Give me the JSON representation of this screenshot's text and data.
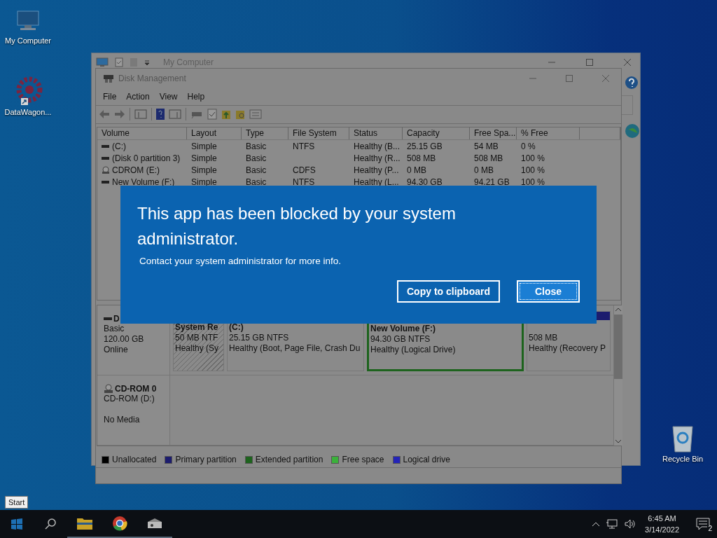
{
  "desktop_icons": [
    {
      "kind": "computer",
      "label": "My Computer"
    },
    {
      "kind": "shortcut",
      "label": "DataWagon..."
    },
    {
      "kind": "bin",
      "label": "Recycle Bin"
    }
  ],
  "back_window": {
    "title": "My Computer"
  },
  "disk_management": {
    "title": "Disk Management",
    "menu": [
      "File",
      "Action",
      "View",
      "Help"
    ],
    "table": {
      "columns": [
        "Volume",
        "Layout",
        "Type",
        "File System",
        "Status",
        "Capacity",
        "Free Spa...",
        "% Free"
      ],
      "rows": [
        {
          "kind": "volume",
          "cells": [
            " (C:)",
            "Simple",
            "Basic",
            "NTFS",
            "Healthy (B...",
            "25.15 GB",
            "54 MB",
            "0 %"
          ]
        },
        {
          "kind": "volume",
          "cells": [
            "(Disk 0 partition 3)",
            "Simple",
            "Basic",
            "",
            "Healthy (R...",
            "508 MB",
            "508 MB",
            "100 %"
          ]
        },
        {
          "kind": "cdrom",
          "cells": [
            "CDROM (E:)",
            "Simple",
            "Basic",
            "CDFS",
            "Healthy (P...",
            "0 MB",
            "0 MB",
            "100 %"
          ]
        },
        {
          "kind": "volume",
          "cells": [
            "New Volume (F:)",
            "Simple",
            "Basic",
            "NTFS",
            "Healthy (L...",
            "94.30 GB",
            "94.21 GB",
            "100 %"
          ]
        }
      ]
    },
    "disks": [
      {
        "kind": "disk",
        "name": "D",
        "lines": [
          "Basic",
          "120.00 GB",
          "Online"
        ],
        "partitions": [
          {
            "kind": "primary",
            "selected": true,
            "name": "System Re",
            "size": "50 MB NTF",
            "status": "Healthy (Sy"
          },
          {
            "kind": "primary",
            "selected": false,
            "name": " (C:)",
            "size": "25.15 GB NTFS",
            "status": "Healthy (Boot, Page File, Crash Du"
          },
          {
            "kind": "logical",
            "selected": false,
            "name": "New Volume  (F:)",
            "size": "94.30 GB NTFS",
            "status": "Healthy (Logical Drive)"
          },
          {
            "kind": "primary",
            "selected": false,
            "size": "508 MB",
            "status": "Healthy (Recovery P"
          }
        ]
      },
      {
        "kind": "cdrom",
        "name": "CD-ROM 0",
        "lines": [
          "CD-ROM (D:)"
        ],
        "status": "No Media"
      }
    ],
    "legend": [
      {
        "label": "Unallocated",
        "color": "#000000"
      },
      {
        "label": "Primary partition",
        "color": "#1c1c6e"
      },
      {
        "label": "Extended partition",
        "color": "#1d631d"
      },
      {
        "label": "Free space",
        "color": "#3bb13b"
      },
      {
        "label": "Logical drive",
        "color": "#2424b8"
      }
    ]
  },
  "dialog": {
    "title": "This app has been blocked by your system administrator.",
    "message": "Contact your system administrator for more info.",
    "buttons": [
      {
        "label": "Copy to clipboard",
        "selected": false
      },
      {
        "label": "Close",
        "selected": true
      }
    ]
  },
  "tooltip": "Start",
  "taskbar": {
    "time": "6:45 AM",
    "date": "3/14/2022",
    "notification_count": "2"
  }
}
